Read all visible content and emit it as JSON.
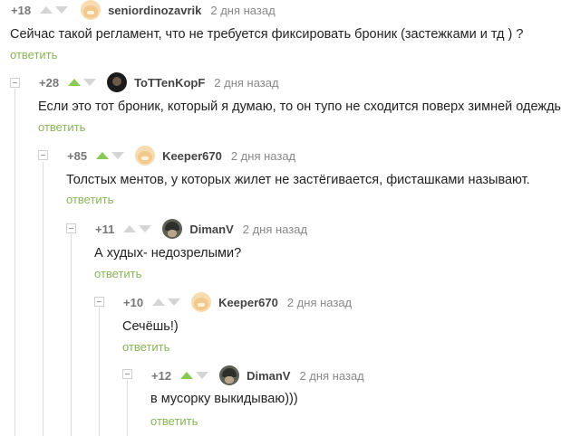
{
  "comments": [
    {
      "rating": "+18",
      "author": "seniordinozavrik",
      "date": "2 дня назад",
      "text": "Сейчас такой регламент, что не требуется фиксировать броник (застежками и тд ) ?",
      "reply": "ответить",
      "avatar_icon": "doge-avatar-icon"
    },
    {
      "rating": "+28",
      "author": "ToTTenKopF",
      "date": "2 дня назад",
      "text": "Если это тот броник, который я думаю, то он тупо не сходится поверх зимней одежды",
      "reply": "ответить",
      "avatar_icon": "dark-avatar-icon"
    },
    {
      "rating": "+85",
      "author": "Keeper670",
      "date": "2 дня назад",
      "text": "Толстых ментов, у которых жилет не застёгивается, фисташками называют.",
      "reply": "ответить",
      "avatar_icon": "doge-avatar-icon"
    },
    {
      "rating": "+11",
      "author": "DimanV",
      "date": "2 дня назад",
      "text": "А худых- недозрелыми?",
      "reply": "ответить",
      "avatar_icon": "gray-avatar-icon"
    },
    {
      "rating": "+10",
      "author": "Keeper670",
      "date": "2 дня назад",
      "text": "Сечёшь!)",
      "reply": "ответить",
      "avatar_icon": "doge-avatar-icon"
    },
    {
      "rating": "+12",
      "author": "DimanV",
      "date": "2 дня назад",
      "text": "в мусорку выкидываю)))",
      "reply": "ответить",
      "avatar_icon": "gray-avatar-icon"
    }
  ],
  "colors": {
    "upvote_active": "#8ac858",
    "vote_inactive": "#d5d5d5",
    "reply_link": "#8ab55a"
  }
}
